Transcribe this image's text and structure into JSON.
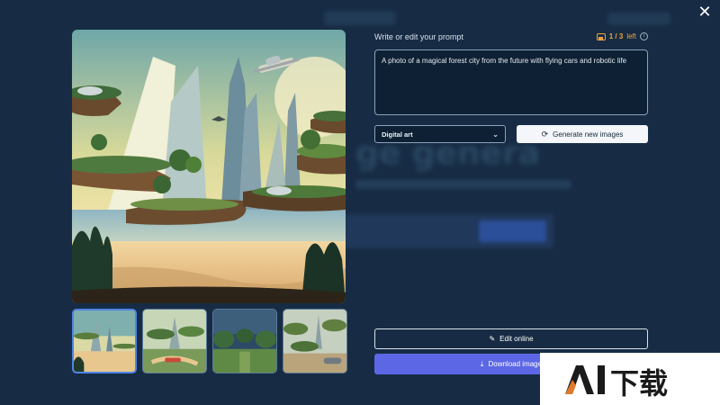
{
  "modal": {
    "close_label": "✕",
    "prompt_label": "Write or edit your prompt",
    "credits": {
      "count": "1 / 3",
      "suffix": "left"
    },
    "prompt_text": "A photo of a magical forest city from the future with flying cars and robotic life",
    "style_select": {
      "selected": "Digital art"
    },
    "generate_label": "Generate new images",
    "edit_label": "Edit online",
    "download_label": "Download image"
  },
  "thumbnails": [
    {
      "selected": true
    },
    {
      "selected": false
    },
    {
      "selected": false
    },
    {
      "selected": false
    }
  ],
  "watermark": {
    "text": "AI下载"
  },
  "icons": [
    "close-icon",
    "gallery-icon",
    "info-icon",
    "chevron-down-icon",
    "refresh-icon",
    "pencil-icon",
    "download-icon"
  ],
  "colors": {
    "background": "#172c44",
    "accent": "#5c67e6",
    "credits": "#f0a23a",
    "selected_thumb": "#4f84e6"
  }
}
